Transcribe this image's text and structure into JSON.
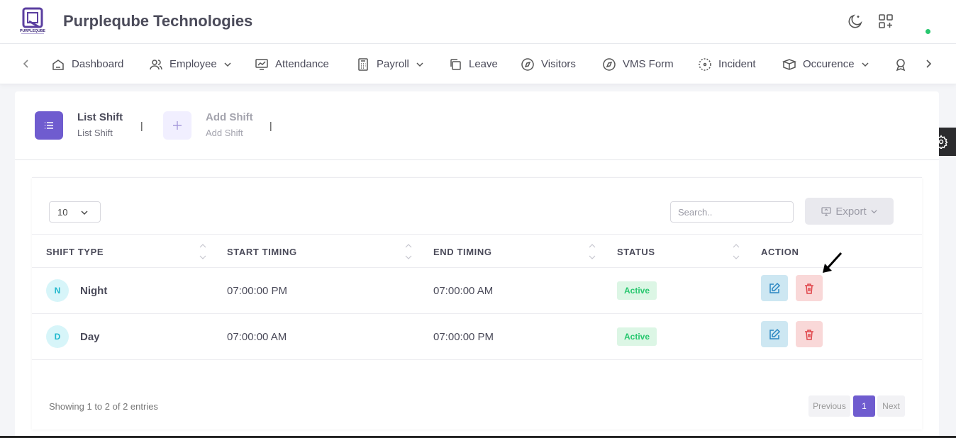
{
  "header": {
    "company": "Purpleqube Technologies",
    "logo_text": "PURPLEQUBE",
    "icons": [
      "moon-icon",
      "apps-add-icon"
    ],
    "status_color": "#28c76f"
  },
  "nav": {
    "items": [
      {
        "label": "Dashboard",
        "icon": "home-icon"
      },
      {
        "label": "Employee",
        "icon": "users-icon",
        "dropdown": true
      },
      {
        "label": "Attendance",
        "icon": "chart-icon"
      },
      {
        "label": "Payroll",
        "icon": "calculator-icon",
        "dropdown": true
      },
      {
        "label": "Leave",
        "icon": "copy-icon"
      },
      {
        "label": "Visitors",
        "icon": "compass-icon"
      },
      {
        "label": "VMS Form",
        "icon": "compass-icon"
      },
      {
        "label": "Incident",
        "icon": "focus-icon"
      },
      {
        "label": "Occurence",
        "icon": "boxes-icon",
        "dropdown": true
      },
      {
        "label": "",
        "icon": "award-icon"
      }
    ]
  },
  "tabs": [
    {
      "title": "List Shift",
      "subtitle": "List Shift",
      "active": true
    },
    {
      "title": "Add Shift",
      "subtitle": "Add Shift",
      "active": false
    }
  ],
  "table_controls": {
    "page_length": "10",
    "search_placeholder": "Search..",
    "export_label": "Export"
  },
  "table": {
    "columns": [
      "SHIFT TYPE",
      "START TIMING",
      "END TIMING",
      "STATUS",
      "ACTION"
    ],
    "rows": [
      {
        "initial": "N",
        "shift_type": "Night",
        "start": "07:00:00 PM",
        "end": "07:00:00 AM",
        "status": "Active"
      },
      {
        "initial": "D",
        "shift_type": "Day",
        "start": "07:00:00 AM",
        "end": "07:00:00 PM",
        "status": "Active"
      }
    ]
  },
  "footer": {
    "info": "Showing 1 to 2 of 2 entries",
    "previous": "Previous",
    "page": "1",
    "next": "Next"
  },
  "colors": {
    "accent": "#6f5ccf",
    "status_active_bg": "#dcf6e5",
    "status_active_text": "#28c76f",
    "edit_bg": "#cde7f2",
    "delete_bg": "#f9d8d8"
  }
}
